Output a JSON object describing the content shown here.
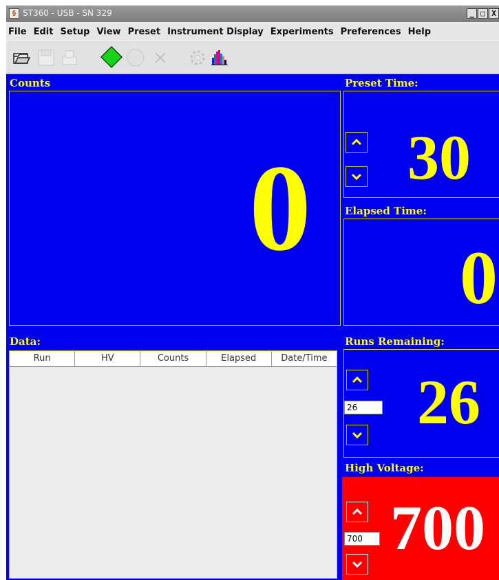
{
  "window": {
    "title": "ST360 - USB - SN 329"
  },
  "window_buttons": {
    "minimize": "_",
    "maximize": "□",
    "close": "X"
  },
  "menubar": [
    "File",
    "Edit",
    "Setup",
    "View",
    "Preset",
    "Instrument Display",
    "Experiments",
    "Preferences",
    "Help"
  ],
  "toolbar": {
    "buttons": [
      {
        "icon": "folder-open-icon",
        "enabled": true
      },
      {
        "icon": "save-icon",
        "enabled": false
      },
      {
        "icon": "print-icon",
        "enabled": false
      },
      {
        "icon": "start-diamond-icon",
        "enabled": true
      },
      {
        "icon": "stop-circle-icon",
        "enabled": false
      },
      {
        "icon": "clear-x-icon",
        "enabled": false
      },
      {
        "icon": "settings-gear-icon",
        "enabled": false
      },
      {
        "icon": "histogram-icon",
        "enabled": true
      }
    ]
  },
  "counts": {
    "label": "Counts",
    "value": "0"
  },
  "preset_time": {
    "label": "Preset Time:",
    "value": "30"
  },
  "elapsed_time": {
    "label": "Elapsed Time:",
    "value": "0"
  },
  "data_table": {
    "label": "Data:",
    "columns": [
      "Run",
      "HV",
      "Counts",
      "Elapsed",
      "Date/Time"
    ],
    "rows": []
  },
  "runs_remaining": {
    "label": "Runs Remaining:",
    "value": "26",
    "input_value": "26"
  },
  "high_voltage": {
    "label": "High Voltage:",
    "value": "700",
    "input_value": "700"
  },
  "colors": {
    "panel_bg": "#0000f0",
    "accent_text": "#ffff00",
    "hv_bg": "#ff0000"
  }
}
